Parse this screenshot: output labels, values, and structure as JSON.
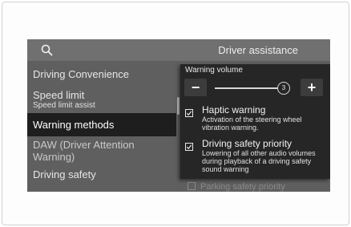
{
  "header": {
    "title": "Driver assistance",
    "search_icon": "search-icon"
  },
  "menu": {
    "items": [
      {
        "label": "Driving Convenience"
      },
      {
        "label": "Speed limit",
        "sublabel": "Speed limit assist"
      },
      {
        "label": "Warning methods",
        "active": true
      },
      {
        "label": "DAW (Driver Attention Warning)"
      },
      {
        "label": "Driving safety"
      }
    ]
  },
  "popup": {
    "volume_label": "Warning volume",
    "minus_label": "−",
    "plus_label": "+",
    "volume_value": "3",
    "options": [
      {
        "title": "Haptic warning",
        "description": "Activation of the steering wheel vibration warning.",
        "checked": true
      },
      {
        "title": "Driving safety priority",
        "description": "Lowering of all other audio volumes during playback of a driving safety sound warning",
        "checked": true
      }
    ]
  },
  "peek_option": {
    "title": "Parking safety priority"
  },
  "colors": {
    "screen_bg": "#5f5f5f",
    "header_bg": "#707070",
    "active_bg": "#1e1e1e",
    "popup_bg": "#262626"
  }
}
